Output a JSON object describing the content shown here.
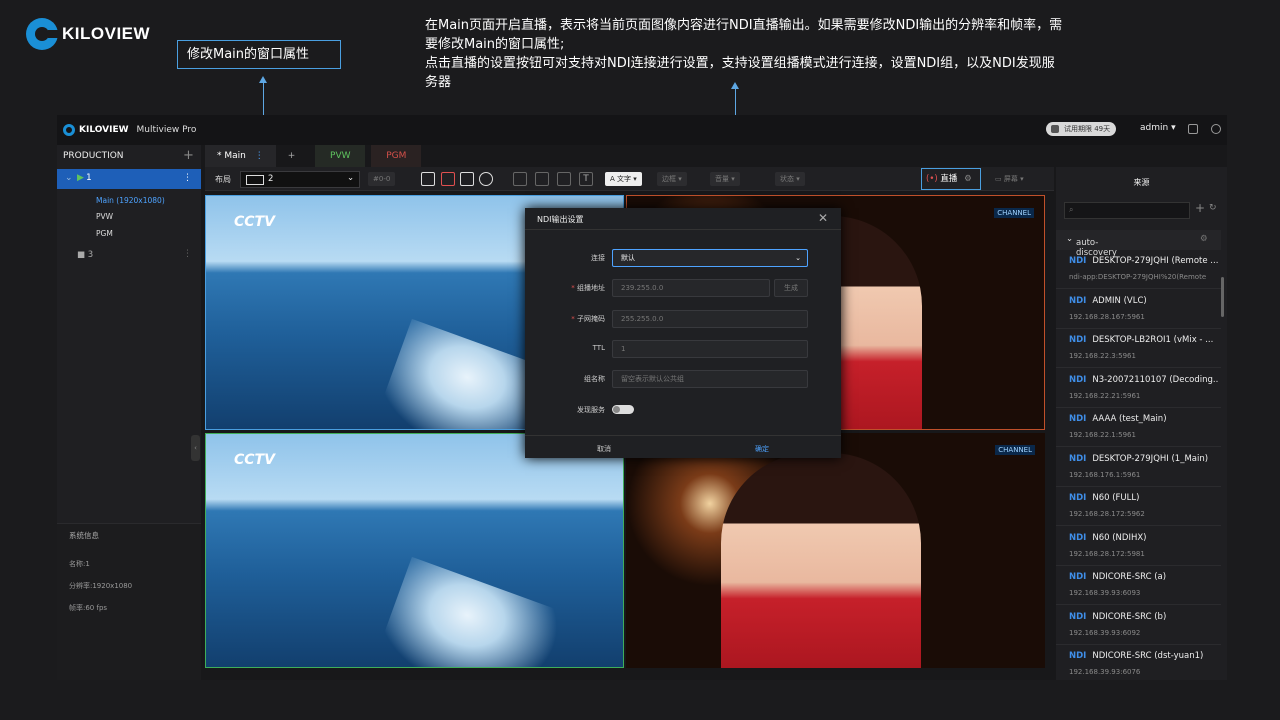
{
  "brand": {
    "logo_text": "KILOVIEW"
  },
  "annotations": {
    "callout": "修改Main的窗口属性",
    "note": [
      "在Main页面开启直播，表示将当前页面图像内容进行NDI直播输出。如果需要修改NDI输出的分辨率和帧率，需要修改Main的窗口属性;",
      "点击直播的设置按钮可对支持对NDI连接进行设置，支持设置组播模式进行连接，设置NDI组，以及NDI发现服务器"
    ]
  },
  "app": {
    "name": "Multiview Pro",
    "trial": "试用期限 49天",
    "user": "admin"
  },
  "sidebar": {
    "title": "PRODUCTION",
    "item1": "1",
    "sub": [
      "Main (1920x1080)",
      "PVW",
      "PGM"
    ],
    "item3": "3",
    "sysinfo": {
      "title": "系统信息",
      "name": "名称:1",
      "resolution": "分辨率:1920x1080",
      "fps": "帧率:60 fps"
    }
  },
  "tabs": {
    "main": "* Main",
    "pvw": "PVW",
    "pgm": "PGM"
  },
  "toolbar": {
    "layout_label": "布局",
    "layout_value": "2",
    "disabled_val": "#0-0",
    "text": "文字",
    "border": "边框",
    "volume": "音量",
    "status": "状态",
    "live": "直播",
    "screen": "屏幕"
  },
  "video": {
    "cctv": "CCTV",
    "channel": "CHANNEL"
  },
  "dialog": {
    "title": "NDI输出设置",
    "conn_label": "连接",
    "conn_value": "默认",
    "mc_label": "组播地址",
    "mc_value": "239.255.0.0",
    "gen": "生成",
    "mask_label": "子网掩码",
    "mask_value": "255.255.0.0",
    "ttl_label": "TTL",
    "ttl_value": "1",
    "group_label": "组名称",
    "group_placeholder": "留空表示默认公共组",
    "disc_label": "发现服务",
    "cancel": "取消",
    "ok": "确定"
  },
  "sources": {
    "title": "来源",
    "group": "auto-discovery",
    "badge": "NDI",
    "items": [
      {
        "name": "DESKTOP-279JQHI (Remote ...",
        "addr": "ndi-app:DESKTOP-279JQHI%20(Remote"
      },
      {
        "name": "ADMIN (VLC)",
        "addr": "192.168.28.167:5961"
      },
      {
        "name": "DESKTOP-LB2ROI1 (vMix - ...",
        "addr": "192.168.22.3:5961"
      },
      {
        "name": "N3-20072110107 (Decoding...",
        "addr": "192.168.22.21:5961"
      },
      {
        "name": "AAAA (test_Main)",
        "addr": "192.168.22.1:5961"
      },
      {
        "name": "DESKTOP-279JQHI (1_Main)",
        "addr": "192.168.176.1:5961"
      },
      {
        "name": "N60 (FULL)",
        "addr": "192.168.28.172:5962"
      },
      {
        "name": "N60 (NDIHX)",
        "addr": "192.168.28.172:5981"
      },
      {
        "name": "NDICORE-SRC (a)",
        "addr": "192.168.39.93:6093"
      },
      {
        "name": "NDICORE-SRC (b)",
        "addr": "192.168.39.93:6092"
      },
      {
        "name": "NDICORE-SRC (dst-yuan1)",
        "addr": "192.168.39.93:6076"
      }
    ]
  }
}
